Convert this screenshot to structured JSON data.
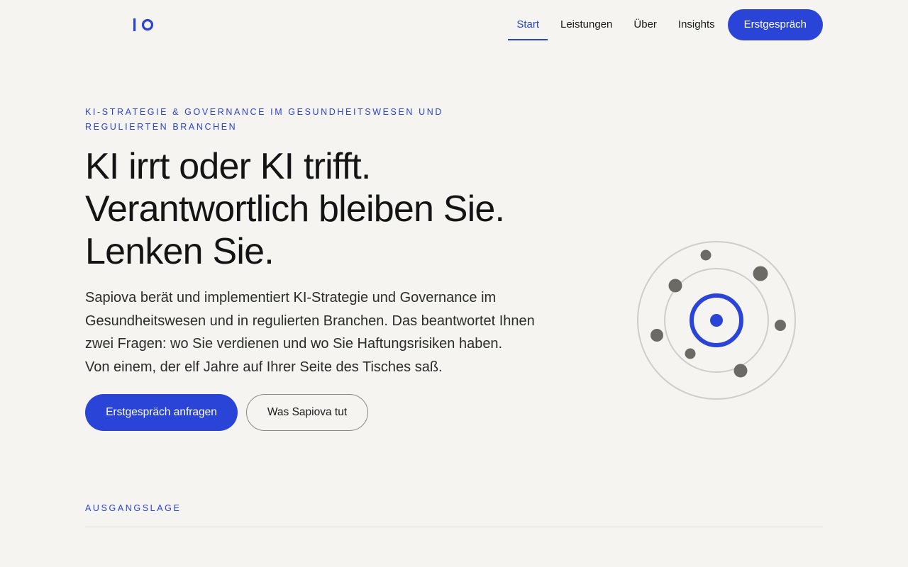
{
  "nav": {
    "items": [
      {
        "label": "Start",
        "active": true
      },
      {
        "label": "Leistungen",
        "active": false
      },
      {
        "label": "Über",
        "active": false
      },
      {
        "label": "Insights",
        "active": false
      }
    ],
    "cta_label": "Erstgespräch"
  },
  "hero": {
    "eyebrow": "KI-Strategie & Governance im Gesundheitswesen und regulierten Branchen",
    "headline": [
      "KI irrt oder KI trifft.",
      "Verantwortlich bleiben Sie.",
      "Lenken Sie."
    ],
    "lead": [
      "Sapiova berät und implementiert KI-Strategie und Governance im",
      "Gesundheitswesen und in regulierten Branchen. Das beantwortet Ihnen",
      "zwei Fragen: wo Sie verdienen und wo Sie Haftungsrisiken haben.",
      "Von einem, der elf Jahre auf Ihrer Seite des Tisches saß."
    ],
    "primary_button": "Erstgespräch anfragen",
    "secondary_button": "Was Sapiova tut"
  },
  "section": {
    "label": "AUSGANGSLAGE"
  },
  "colors": {
    "accent": "#2a44d8",
    "background": "#f5f4f1",
    "dot": "#6b6a65",
    "ring": "#cfcdc8"
  },
  "icons": {
    "logo": "logo-mark-icon",
    "illustration": "orbit-illustration-icon"
  }
}
